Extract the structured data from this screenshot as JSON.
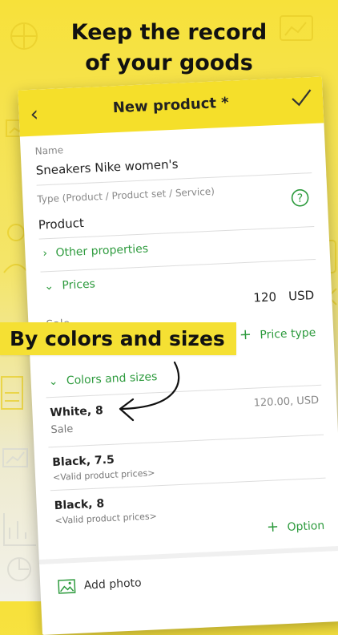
{
  "headline": {
    "line1": "Keep the record",
    "line2": "of your goods"
  },
  "banner": "By colors and sizes",
  "topbar": {
    "title": "New product *"
  },
  "form": {
    "name_label": "Name",
    "name_value": "Sneakers Nike women's",
    "type_label": "Type (Product / Product set / Service)",
    "type_value": "Product",
    "other_properties": "Other properties",
    "prices": "Prices",
    "price_value": "120",
    "currency": "USD",
    "sale_label": "Sale",
    "price_type_button": "Price type",
    "colors_sizes": "Colors and sizes",
    "variants": [
      {
        "title": "White, 8",
        "sub": "Sale",
        "price": "120.00, USD"
      },
      {
        "title": "Black, 7.5",
        "sub": "<Valid product prices>"
      },
      {
        "title": "Black, 8",
        "sub": "<Valid product prices>"
      }
    ],
    "option_button": "Option",
    "add_photo": "Add photo"
  },
  "colors": {
    "accent_yellow": "#f5df2a",
    "green": "#2e9b3e"
  }
}
